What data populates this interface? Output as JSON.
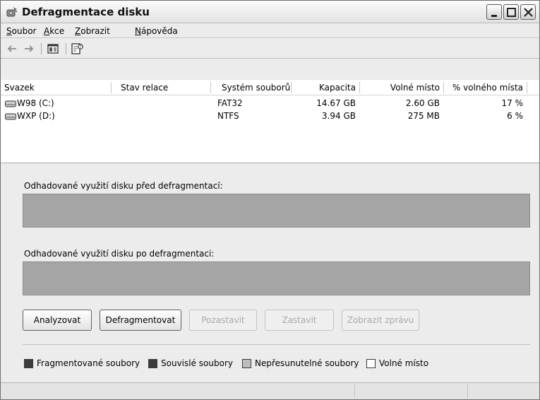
{
  "window": {
    "title": "Defragmentace disku"
  },
  "menu": {
    "items": [
      {
        "mnemonic": "S",
        "rest": "oubor"
      },
      {
        "mnemonic": "A",
        "rest": "kce"
      },
      {
        "mnemonic": "Z",
        "rest": "obrazit"
      },
      {
        "mnemonic": "N",
        "rest": "ápověda"
      }
    ]
  },
  "toolbar": {
    "icons": [
      "back-arrow-icon",
      "forward-arrow-icon",
      "show-hide-console-tree-icon",
      "help-icon"
    ]
  },
  "list": {
    "columns": [
      "Svazek",
      "Stav relace",
      "Systém souborů",
      "Kapacita",
      "Volné místo",
      "% volného místa"
    ],
    "rows": [
      {
        "volume": "W98 (C:)",
        "status": "",
        "fs": "FAT32",
        "capacity": "14.67 GB",
        "free": "2.60 GB",
        "pct": "17 %"
      },
      {
        "volume": "WXP (D:)",
        "status": "",
        "fs": "NTFS",
        "capacity": "3.94 GB",
        "free": "275 MB",
        "pct": "6 %"
      }
    ]
  },
  "panel": {
    "before_label": "Odhadované využití disku před defragmentací:",
    "after_label": "Odhadované využití disku po defragmentaci:"
  },
  "buttons": {
    "analyze": "Analyzovat",
    "defragment": "Defragmentovat",
    "pause": "Pozastavit",
    "stop": "Zastavit",
    "report": "Zobrazit zprávu"
  },
  "legend": {
    "fragmented": "Fragmentované soubory",
    "contiguous": "Souvislé soubory",
    "unmovable": "Nepřesunutelné soubory",
    "free": "Volné místo",
    "colors": {
      "fragmented": "#3c3c3c",
      "contiguous": "#3c3c3c",
      "unmovable": "#bdbdbd",
      "free": "#ffffff"
    }
  }
}
